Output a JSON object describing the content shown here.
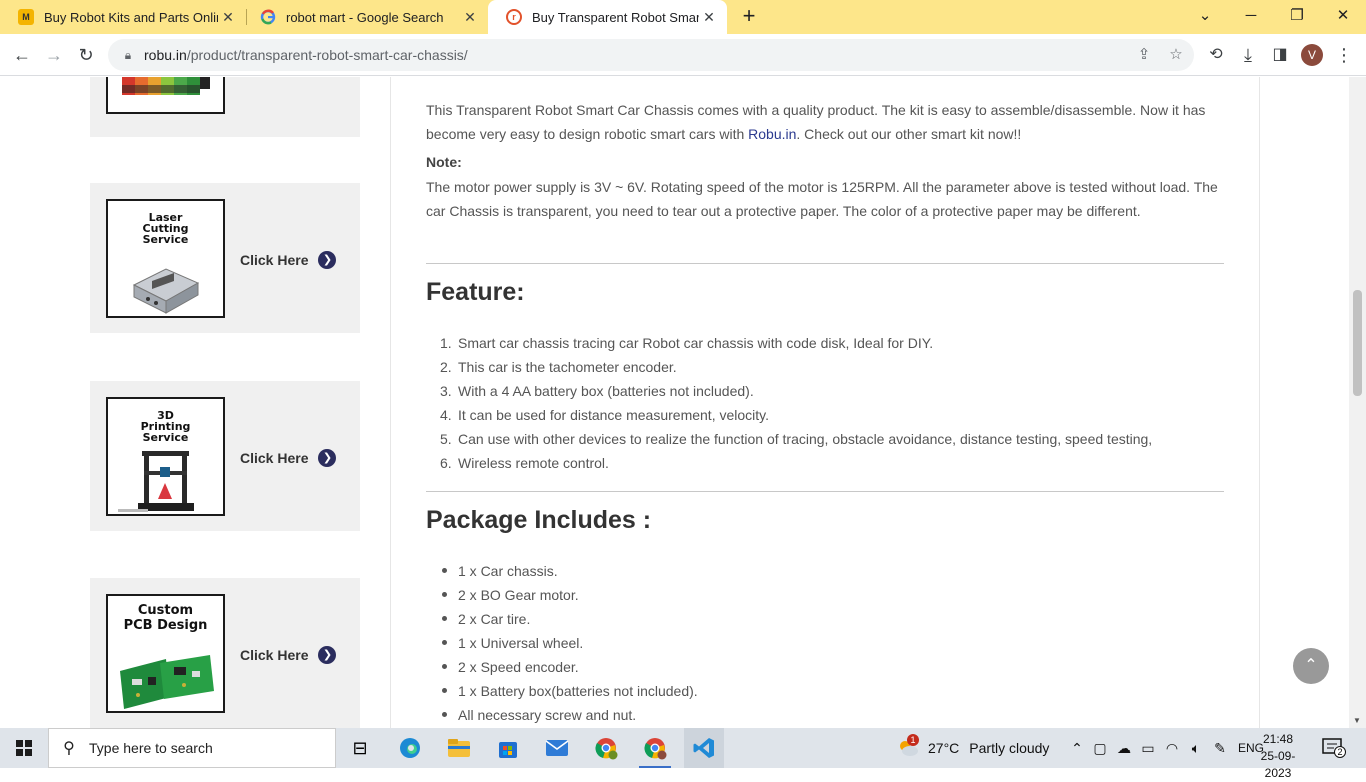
{
  "browser": {
    "tabs": [
      {
        "title": "Buy Robot Kits and Parts Online",
        "favicon": "mart-icon",
        "active": false
      },
      {
        "title": "robot mart - Google Search",
        "favicon": "google-icon",
        "active": false
      },
      {
        "title": "Buy Transparent Robot Smart Ca",
        "favicon": "robu-icon",
        "active": true
      }
    ],
    "close_glyph": "✕",
    "new_tab_glyph": "+",
    "url_host": "robu.in",
    "url_path": "/product/transparent-robot-smart-car-chassis/",
    "profile_initial": "V"
  },
  "sidebar": {
    "services": [
      {
        "title_lines": [
          "Laser",
          "Cutting",
          "Service"
        ],
        "cta": "Click Here",
        "image": "laser-cut-case-image"
      },
      {
        "title_lines": [
          "3D",
          "Printing",
          "Service"
        ],
        "cta": "Click Here",
        "image": "3d-printer-image"
      },
      {
        "title_lines": [
          "Custom",
          "PCB Design"
        ],
        "cta": "Click Here",
        "image": "pcb-boards-image"
      }
    ]
  },
  "product": {
    "intro_part1": "This Transparent Robot Smart Car Chassis comes with a quality product. The kit is easy to assemble/disassemble. Now it has become very easy to design robotic smart cars with ",
    "intro_link": "Robu.in",
    "intro_part2": ". Check out our other smart kit now!!",
    "note_label": "Note:",
    "note_text": "The motor power supply is 3V ~ 6V.  Rotating speed of the motor is 125RPM. All the parameter above is tested without load. The car Chassis is transparent, you need to tear out a protective paper. The color of a protective paper may be different.",
    "feature_heading": "Feature:",
    "features": [
      "Smart car chassis tracing car Robot car chassis with code disk, Ideal for DIY.",
      "This car is the tachometer encoder.",
      "With a 4 AA battery box (batteries not included).",
      "It can be used for distance measurement, velocity.",
      "Can use with other devices to realize the function of tracing, obstacle avoidance, distance testing, speed testing,",
      "Wireless remote control."
    ],
    "package_heading": "Package Includes :",
    "package_items": [
      "1 x Car chassis.",
      "2 x BO Gear motor.",
      "2 x Car tire.",
      "1 x Universal wheel.",
      "2 x Speed encoder.",
      "1 x Battery box(batteries not included).",
      "All necessary screw and nut."
    ]
  },
  "taskbar": {
    "search_placeholder": "Type here to search",
    "weather_temp": "27°C",
    "weather_desc": "Partly cloudy",
    "weather_badge": "1",
    "language": "ENG",
    "time": "21:48",
    "date": "25-09-2023",
    "notification_count": "2"
  }
}
